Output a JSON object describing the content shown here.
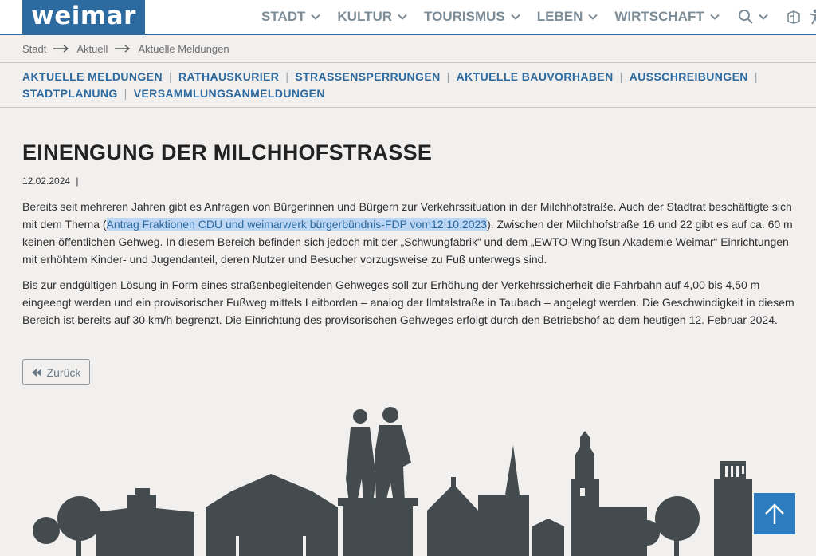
{
  "header": {
    "logo_text": "weimar",
    "nav": [
      {
        "label": "STADT"
      },
      {
        "label": "KULTUR"
      },
      {
        "label": "TOURISMUS"
      },
      {
        "label": "LEBEN"
      },
      {
        "label": "WIRTSCHAFT"
      }
    ],
    "icons": [
      "search-icon",
      "chevron-down-icon",
      "sign-language-icon",
      "accessibility-icon"
    ]
  },
  "breadcrumb": [
    "Stadt",
    "Aktuell",
    "Aktuelle Meldungen"
  ],
  "subnav": {
    "row1": [
      "AKTUELLE MELDUNGEN",
      "RATHAUSKURIER",
      "STRASSENSPERRUNGEN",
      "AKTUELLE BAUVORHABEN",
      "AUSSCHREIBUNGEN"
    ],
    "row2": [
      "STADTPLANUNG",
      "VERSAMMLUNGSANMELDUNGEN"
    ]
  },
  "article": {
    "title": "EINENGUNG DER MILCHHOFSTRASSE",
    "date": "12.02.2024",
    "date_sep": "|",
    "p1_before": "Bereits seit mehreren Jahren gibt es Anfragen von Bürgerinnen und Bürgern zur Verkehrssituation in der Milchhofstraße. Auch der Stadtrat beschäftigte sich mit dem Thema (",
    "p1_link": "Antrag Fraktionen CDU und weimarwerk bürgerbündnis-FDP vom12.10.2023",
    "p1_after": "). Zwischen der Milchhofstraße 16 und 22 gibt es auf ca. 60 m keinen öffentlichen Gehweg. In diesem Bereich befinden sich jedoch mit der „Schwungfabrik“ und dem „EWTO-WingTsun Akademie Weimar“ Einrichtungen mit erhöhtem Kinder- und Jugendanteil, deren Nutzer und Besucher vorzugsweise zu Fuß unterwegs sind.",
    "p2": "Bis zur endgültigen Lösung in Form eines straßenbegleitenden Gehweges soll zur Erhöhung der Verkehrssicherheit die Fahrbahn auf 4,00 bis 4,50 m eingeengt werden und ein provisorischer Fußweg mittels Leitborden – analog der Ilmtalstraße in Taubach – angelegt werden. Die Geschwindigkeit in diesem Bereich ist bereits auf 30 km/h begrenzt. Die Einrichtung des provisorischen Gehweges erfolgt durch den Betriebshof ab dem heutigen 12. Februar 2024."
  },
  "back_button": {
    "label": "Zurück"
  },
  "colors": {
    "brand": "#2c6aa0",
    "nav_gray": "#7d8d98",
    "skyline": "#434b4e",
    "to_top": "#2c7cc0"
  }
}
